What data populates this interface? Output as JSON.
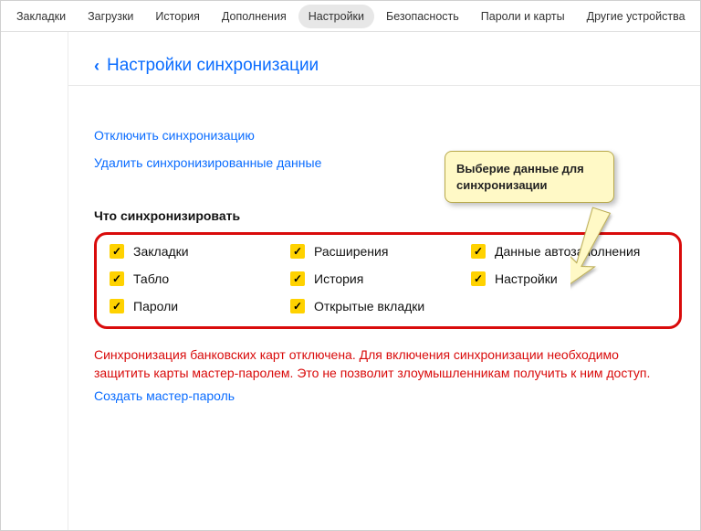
{
  "topbar": {
    "tabs": [
      {
        "label": "Закладки",
        "active": false
      },
      {
        "label": "Загрузки",
        "active": false
      },
      {
        "label": "История",
        "active": false
      },
      {
        "label": "Дополнения",
        "active": false
      },
      {
        "label": "Настройки",
        "active": true
      },
      {
        "label": "Безопасность",
        "active": false
      },
      {
        "label": "Пароли и карты",
        "active": false
      },
      {
        "label": "Другие устройства",
        "active": false
      }
    ]
  },
  "page": {
    "back_chevron": "‹",
    "title": "Настройки синхронизации"
  },
  "links": {
    "disable_sync": "Отключить синхронизацию",
    "delete_synced": "Удалить синхронизированные данные"
  },
  "sync_section": {
    "title": "Что синхронизировать",
    "items": [
      {
        "label": "Закладки",
        "checked": true
      },
      {
        "label": "Расширения",
        "checked": true
      },
      {
        "label": "Данные автозаполнения",
        "checked": true
      },
      {
        "label": "Табло",
        "checked": true
      },
      {
        "label": "История",
        "checked": true
      },
      {
        "label": "Настройки",
        "checked": true
      },
      {
        "label": "Пароли",
        "checked": true
      },
      {
        "label": "Открытые вкладки",
        "checked": true
      }
    ]
  },
  "warning": {
    "text": "Синхронизация банковских карт отключена. Для включения синхронизации необходимо защитить карты мастер-паролем. Это не позволит злоумышленникам получить к ним доступ.",
    "link": "Создать мастер-пароль"
  },
  "callout": {
    "text": "Выберие данные для синхронизации"
  },
  "icons": {
    "check": "✓"
  }
}
